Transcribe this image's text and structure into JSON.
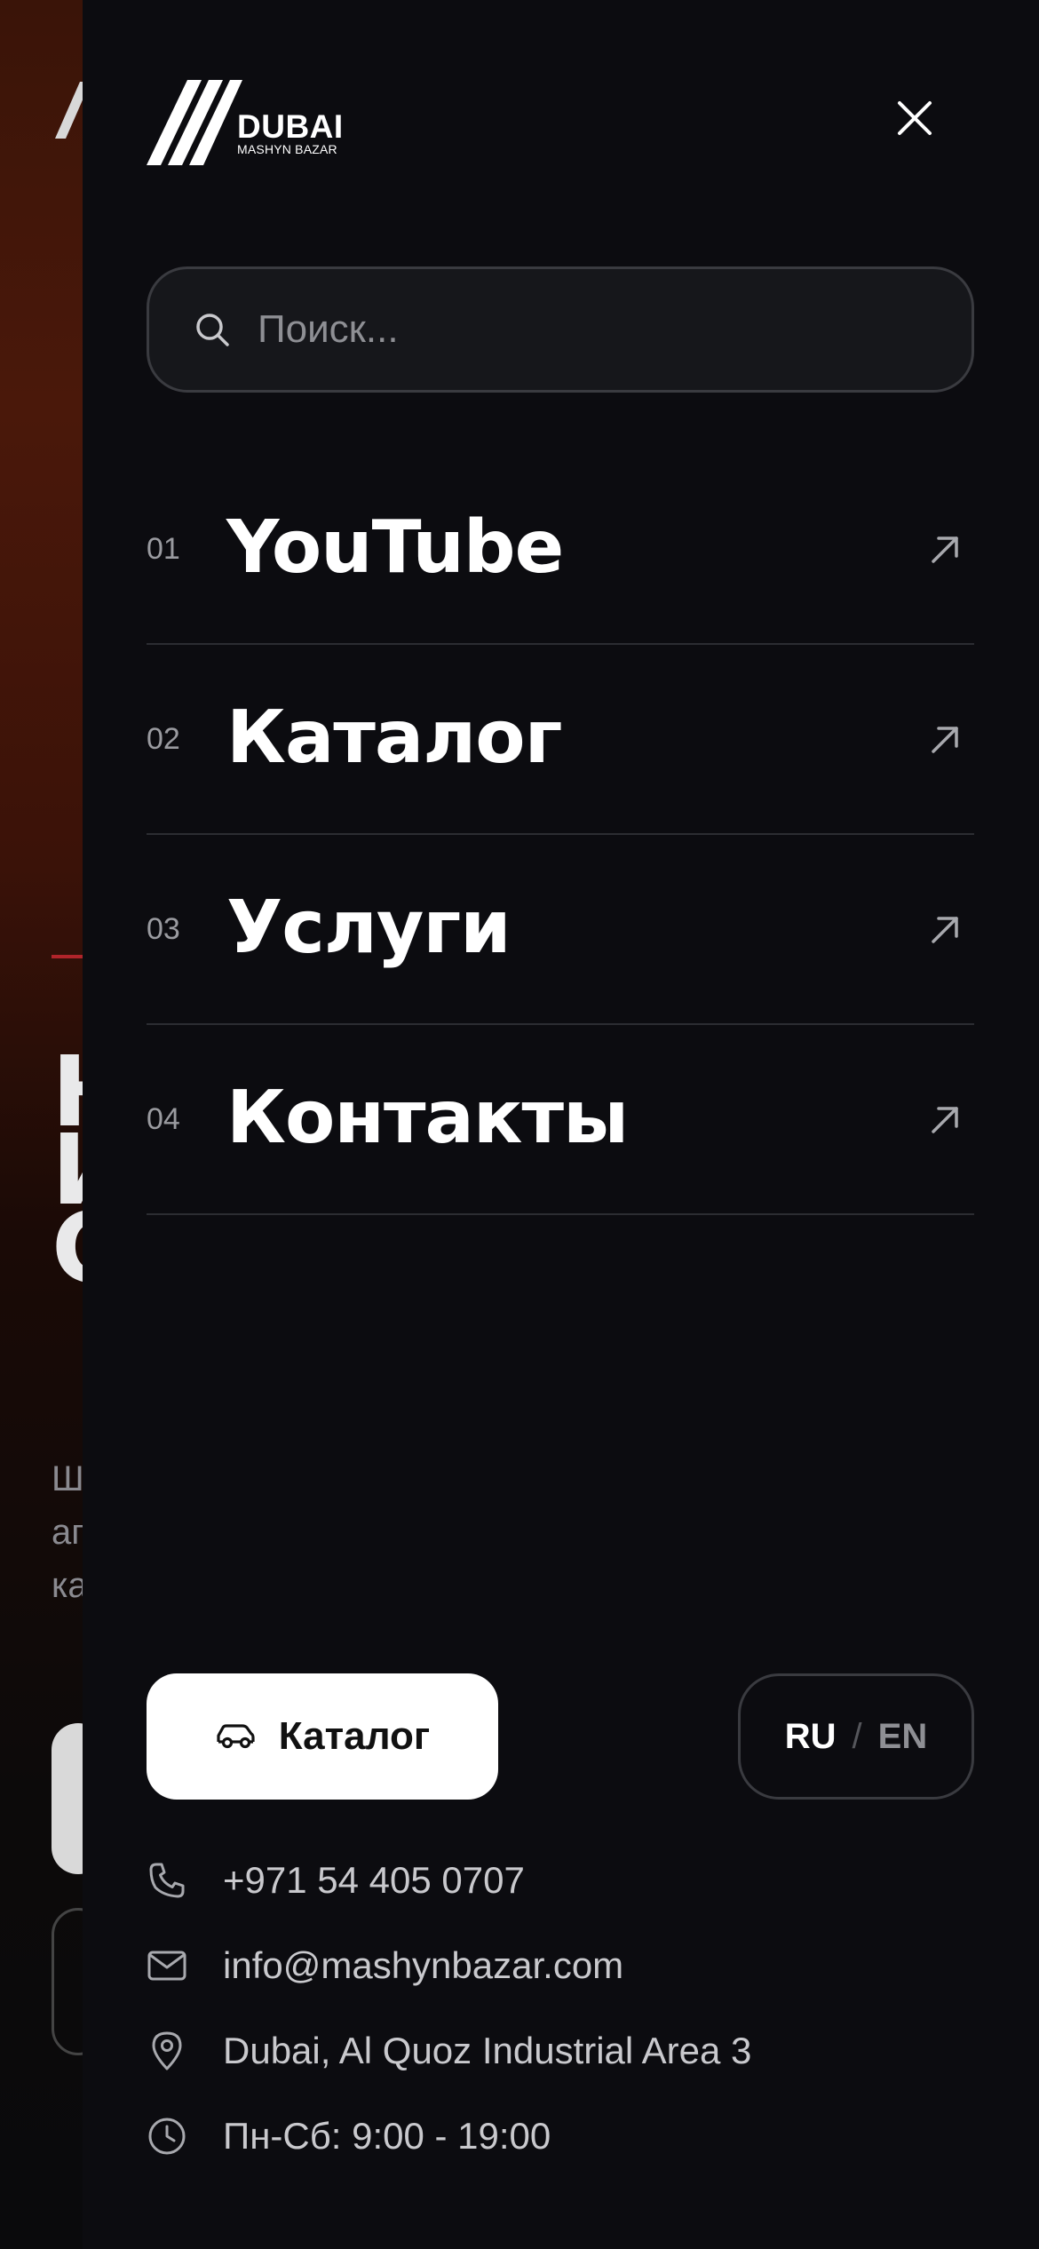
{
  "logo": {
    "main": "DUBAI",
    "sub": "MASHYN BAZAR"
  },
  "search": {
    "placeholder": "Поиск...",
    "value": ""
  },
  "nav": {
    "items": [
      {
        "num": "01",
        "label": "YouTube"
      },
      {
        "num": "02",
        "label": "Каталог"
      },
      {
        "num": "03",
        "label": "Услуги"
      },
      {
        "num": "04",
        "label": "Контакты"
      }
    ]
  },
  "catalog_button": {
    "label": "Каталог"
  },
  "language": {
    "active": "RU",
    "separator": "/",
    "other": "EN"
  },
  "contacts": {
    "phone": "+971 54 405 0707",
    "email": "info@mashynbazar.com",
    "address": "Dubai, Al Quoz Industrial Area 3",
    "hours": "Пн-Сб: 9:00 - 19:00"
  },
  "colors": {
    "drawer_bg": "#0c0c10",
    "text": "#ffffff",
    "muted": "#9a9ba0",
    "divider": "#2c2d32",
    "accent_red": "#b0242a"
  },
  "icons": [
    "close-icon",
    "search-icon",
    "arrow-up-right-icon",
    "car-icon",
    "phone-icon",
    "mail-icon",
    "location-pin-icon",
    "clock-icon"
  ]
}
